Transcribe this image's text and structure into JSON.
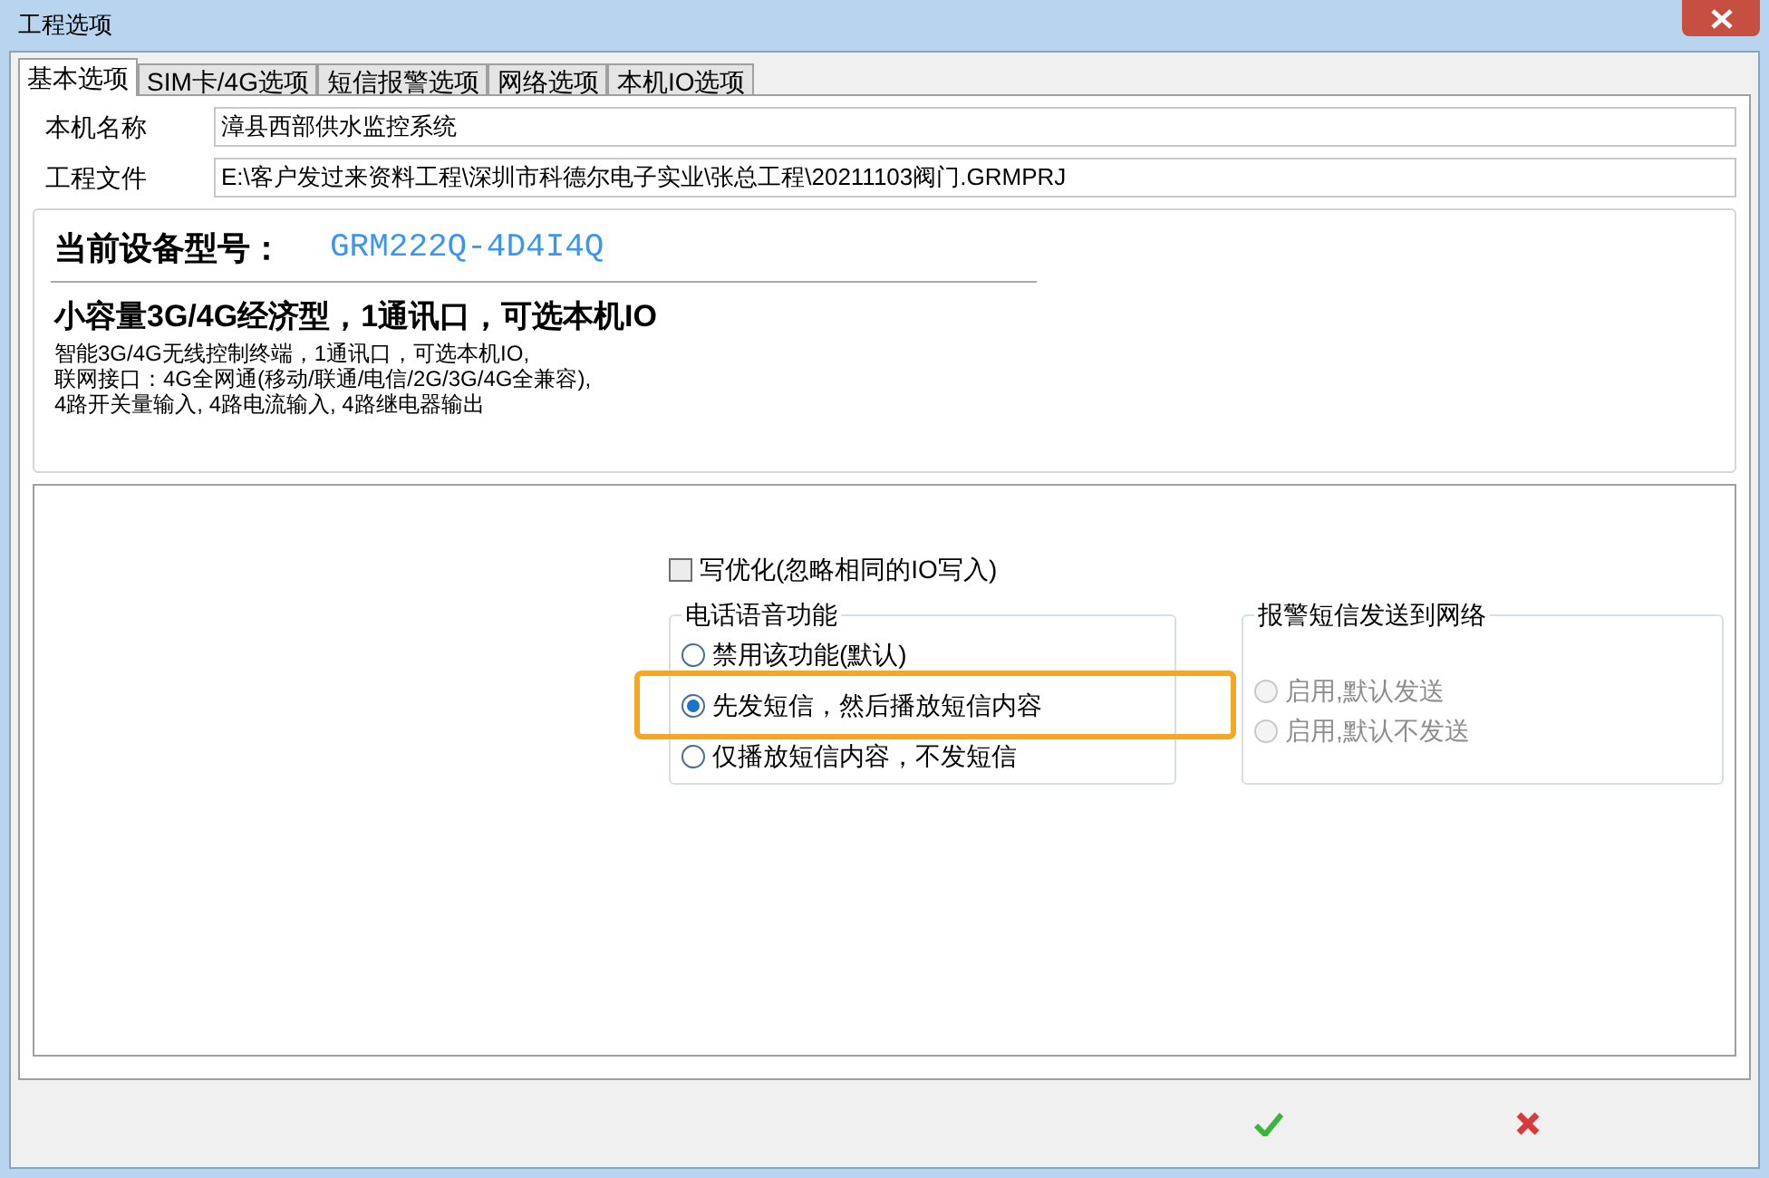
{
  "window": {
    "title": "工程选项"
  },
  "tabs": [
    {
      "label": "基本选项",
      "selected": true
    },
    {
      "label": "SIM卡/4G选项",
      "selected": false
    },
    {
      "label": "短信报警选项",
      "selected": false
    },
    {
      "label": "网络选项",
      "selected": false
    },
    {
      "label": "本机IO选项",
      "selected": false
    }
  ],
  "fields": [
    {
      "label": "本机名称",
      "value": "漳县西部供水监控系统"
    },
    {
      "label": "工程文件",
      "value": "E:\\客户发过来资料工程\\深圳市科德尔电子实业\\张总工程\\20211103阀门.GRMPRJ"
    }
  ],
  "device": {
    "model_label": "当前设备型号：",
    "model": "GRM222Q-4D4I4Q",
    "headline": "小容量3G/4G经济型，1通讯口，可选本机IO",
    "description": [
      "智能3G/4G无线控制终端，1通讯口，可选本机IO,",
      "联网接口：4G全网通(移动/联通/电信/2G/3G/4G全兼容),",
      "4路开关量输入, 4路电流输入, 4路继电器输出"
    ]
  },
  "write_optimize": {
    "label": "写优化(忽略相同的IO写入)",
    "checked": false
  },
  "groups": [
    {
      "title": "电话语音功能",
      "options": [
        {
          "label": "禁用该功能(默认)",
          "selected": false,
          "disabled": false,
          "highlighted": false
        },
        {
          "label": "先发短信，然后播放短信内容",
          "selected": true,
          "disabled": false,
          "highlighted": true
        },
        {
          "label": "仅播放短信内容，不发短信",
          "selected": false,
          "disabled": false,
          "highlighted": false
        }
      ]
    },
    {
      "title": "报警短信发送到网络",
      "options": [
        {
          "label": "启用,默认发送",
          "selected": false,
          "disabled": true,
          "highlighted": false
        },
        {
          "label": "启用,默认不发送",
          "selected": false,
          "disabled": true,
          "highlighted": false
        }
      ]
    }
  ]
}
